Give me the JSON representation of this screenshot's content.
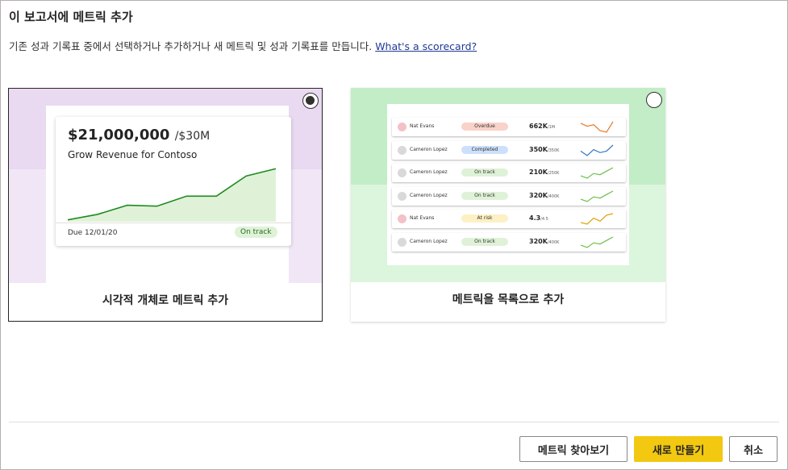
{
  "dialog": {
    "title": "이 보고서에 메트릭 추가",
    "subtitle": "기존 성과 기록표 중에서 선택하거나 추가하거나 새 메트릭 및 성과 기록표를 만듭니다.",
    "help_link": "What's a scorecard?"
  },
  "options": [
    {
      "label": "시각적 개체로 메트릭 추가",
      "selected": true,
      "preview": {
        "amount": "$21,000,000",
        "target": "/$30M",
        "name": "Grow Revenue for Contoso",
        "due": "Due 12/01/20",
        "status": "On track",
        "trend": [
          2,
          8,
          18,
          17,
          28,
          28,
          50,
          58
        ]
      }
    },
    {
      "label": "메트릭을 목록으로 추가",
      "selected": false,
      "preview": {
        "rows": [
          {
            "owner": "Nat Evans",
            "status": "Overdue",
            "status_color": "#f9d2c9",
            "dot": "#f3c1c6",
            "value": "662K",
            "target": "/1M",
            "spark_color": "#e87b2a",
            "spark": [
              4,
              6,
              5,
              9,
              10,
              3
            ]
          },
          {
            "owner": "Cameron Lopez",
            "status": "Completed",
            "status_color": "#cde0fb",
            "dot": "#d9d9d9",
            "value": "350K",
            "target": "/350K",
            "spark_color": "#2f7ac2",
            "spark": [
              6,
              9,
              5,
              7,
              6,
              2
            ]
          },
          {
            "owner": "Cameron Lopez",
            "status": "On track",
            "status_color": "#dff2d8",
            "dot": "#d9d9d9",
            "value": "210K",
            "target": "/250K",
            "spark_color": "#6cc04a",
            "spark": [
              9,
              11,
              7,
              8,
              5,
              2
            ]
          },
          {
            "owner": "Cameron Lopez",
            "status": "On track",
            "status_color": "#dff2d8",
            "dot": "#d9d9d9",
            "value": "320K",
            "target": "/400K",
            "spark_color": "#6cc04a",
            "spark": [
              9,
              11,
              7,
              8,
              5,
              2
            ]
          },
          {
            "owner": "Nat Evans",
            "status": "At risk",
            "status_color": "#fdf0c4",
            "dot": "#f3c1c6",
            "value": "4.3",
            "target": "/4.5",
            "spark_color": "#e0a000",
            "spark": [
              9,
              10,
              6,
              8,
              4,
              3
            ]
          },
          {
            "owner": "Cameron Lopez",
            "status": "On track",
            "status_color": "#dff2d8",
            "dot": "#d9d9d9",
            "value": "320K",
            "target": "/400K",
            "spark_color": "#6cc04a",
            "spark": [
              9,
              11,
              7,
              8,
              5,
              2
            ]
          }
        ]
      }
    }
  ],
  "buttons": {
    "browse": "메트릭 찾아보기",
    "create": "새로 만들기",
    "cancel": "취소"
  },
  "colors": {
    "primary_button": "#f2c811",
    "trend_line": "#1f8a1f",
    "trend_fill": "#dff2d8"
  }
}
